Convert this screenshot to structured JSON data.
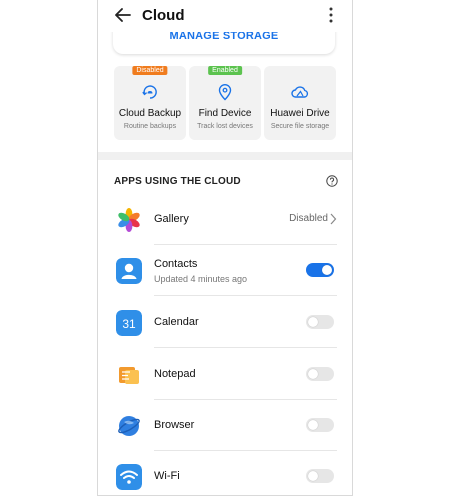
{
  "header": {
    "title": "Cloud",
    "back_icon": "back-arrow-icon",
    "more_icon": "more-vertical-icon"
  },
  "manage": {
    "label": "MANAGE STORAGE"
  },
  "features": [
    {
      "label": "Cloud Backup",
      "sub": "Routine backups",
      "badge": "Disabled",
      "badge_color": "#f07c1e",
      "icon": "cloud-backup-icon"
    },
    {
      "label": "Find Device",
      "sub": "Track lost devices",
      "badge": "Enabled",
      "badge_color": "#5cc34f",
      "icon": "location-pin-icon"
    },
    {
      "label": "Huawei Drive",
      "sub": "Secure file storage",
      "badge": "",
      "icon": "cloud-drive-icon"
    }
  ],
  "section": {
    "title": "APPS USING THE CLOUD",
    "help_icon": "help-icon"
  },
  "apps": [
    {
      "name": "Gallery",
      "status": "Disabled",
      "control": "chevron"
    },
    {
      "name": "Contacts",
      "sub": "Updated 4 minutes ago",
      "toggle": "on"
    },
    {
      "name": "Calendar",
      "icon_text": "31",
      "toggle": "off"
    },
    {
      "name": "Notepad",
      "toggle": "off"
    },
    {
      "name": "Browser",
      "toggle": "off"
    },
    {
      "name": "Wi-Fi",
      "toggle": "off"
    }
  ],
  "colors": {
    "accent": "#1a73e8",
    "enabled": "#5cc34f",
    "disabled": "#f07c1e"
  }
}
